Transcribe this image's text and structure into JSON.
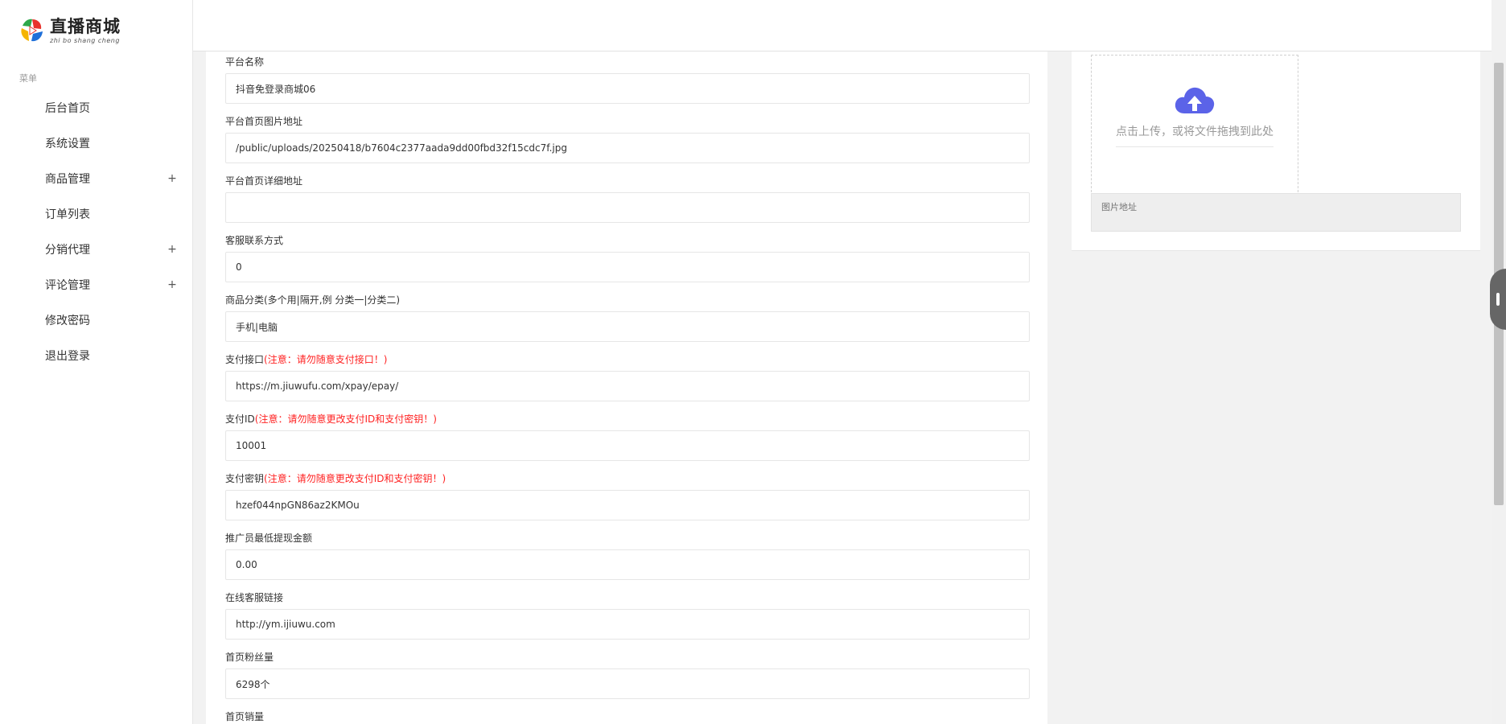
{
  "brand": {
    "title": "直播商城",
    "subtitle": "zhi bo shang cheng",
    "colors": {
      "red": "#e8332c",
      "blue": "#1e6fd9",
      "yellow": "#f5b400",
      "green": "#2ca84a"
    }
  },
  "sidebar": {
    "section_label": "菜单",
    "items": [
      {
        "label": "后台首页",
        "expandable": false
      },
      {
        "label": "系统设置",
        "expandable": false
      },
      {
        "label": "商品管理",
        "expandable": true
      },
      {
        "label": "订单列表",
        "expandable": false
      },
      {
        "label": "分销代理",
        "expandable": true
      },
      {
        "label": "评论管理",
        "expandable": true
      },
      {
        "label": "修改密码",
        "expandable": false
      },
      {
        "label": "退出登录",
        "expandable": false
      }
    ],
    "expand_glyph": "+"
  },
  "form": {
    "fields": [
      {
        "label": "平台名称",
        "warning": "",
        "value": "抖音免登录商城06"
      },
      {
        "label": "平台首页图片地址",
        "warning": "",
        "value": "/public/uploads/20250418/b7604c2377aada9dd00fbd32f15cdc7f.jpg"
      },
      {
        "label": "平台首页详细地址",
        "warning": "",
        "value": ""
      },
      {
        "label": "客服联系方式",
        "warning": "",
        "value": "0"
      },
      {
        "label": "商品分类(多个用|隔开,例 分类一|分类二)",
        "warning": "",
        "value": "手机|电脑"
      },
      {
        "label": "支付接口",
        "warning": "(注意：请勿随意支付接口！)",
        "value": "https://m.jiuwufu.com/xpay/epay/"
      },
      {
        "label": "支付ID",
        "warning": "(注意：请勿随意更改支付ID和支付密钥！)",
        "value": "10001"
      },
      {
        "label": "支付密钥",
        "warning": "(注意：请勿随意更改支付ID和支付密钥！)",
        "value": "hzef044npGN86az2KMOu"
      },
      {
        "label": "推广员最低提现金额",
        "warning": "",
        "value": "0.00"
      },
      {
        "label": "在线客服链接",
        "warning": "",
        "value": "http://ym.ijiuwu.com"
      },
      {
        "label": "首页粉丝量",
        "warning": "",
        "value": "6298个"
      },
      {
        "label": "首页销量",
        "warning": "",
        "value": ""
      }
    ]
  },
  "upload": {
    "icon": "cloud-upload-icon",
    "icon_color": "#5b63e8",
    "hint": "点击上传，或将文件拖拽到此处",
    "url_placeholder": "图片地址"
  }
}
